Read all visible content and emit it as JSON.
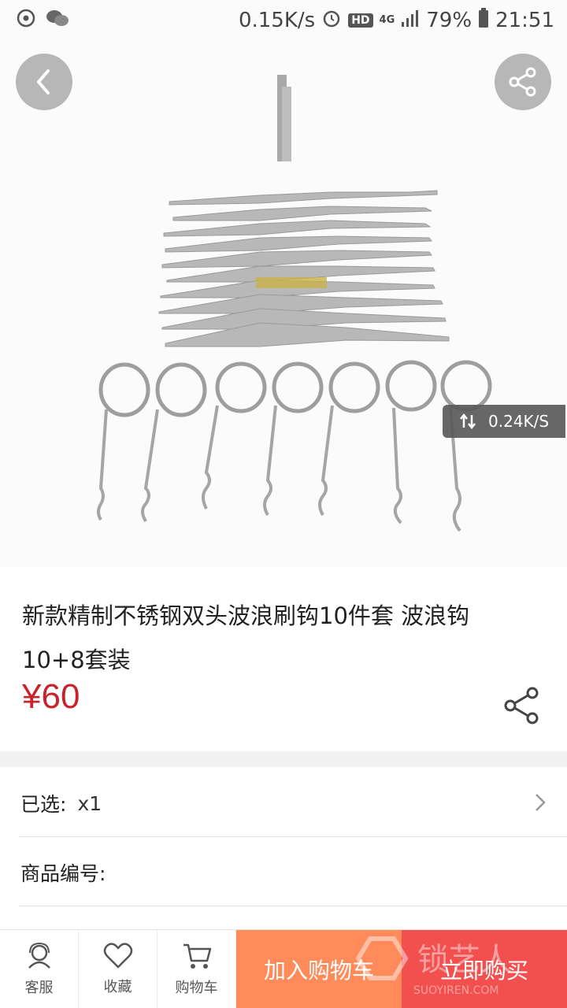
{
  "status_bar": {
    "net_speed": "0.15K/s",
    "hd": "HD",
    "network": "4G",
    "battery": "79%",
    "time": "21:51"
  },
  "hero": {
    "speed_toast": "0.24K/S"
  },
  "product": {
    "title": "新款精制不锈钢双头波浪刷钩10件套 波浪钩10+8套装",
    "price": "¥60"
  },
  "options": {
    "selected_label": "已选:",
    "selected_value": "x1",
    "sku_label": "商品编号:"
  },
  "bottom_bar": {
    "service": "客服",
    "favorite": "收藏",
    "cart": "购物车",
    "add_to_cart": "加入购物车",
    "buy_now": "立即购买"
  },
  "colors": {
    "price": "#c8232c",
    "add_to_cart_bg": "#ff8a5a",
    "buy_now_bg": "#f2504f"
  }
}
